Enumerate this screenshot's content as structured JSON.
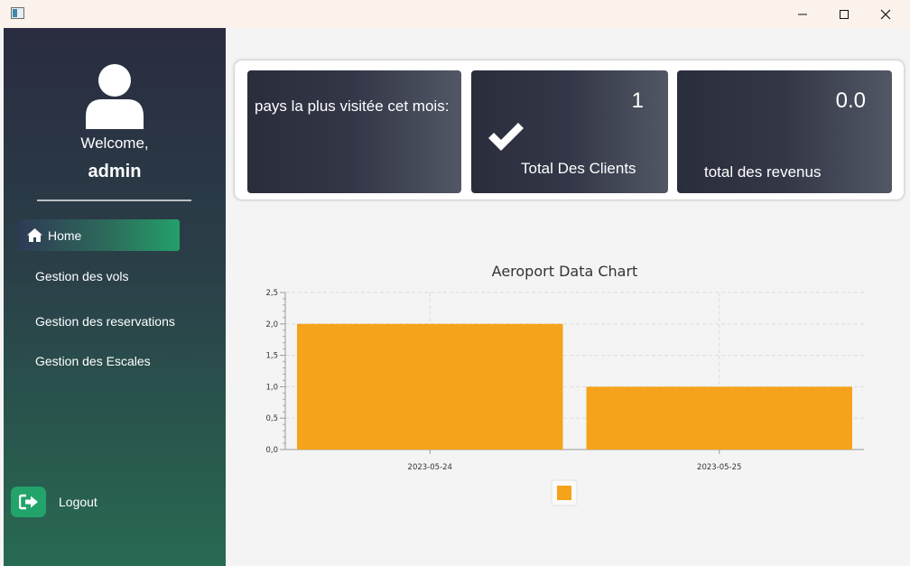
{
  "window": {
    "minimize_glyph": "—",
    "maximize_glyph": "☐",
    "close_glyph": "✕"
  },
  "sidebar": {
    "welcome_text": "Welcome,",
    "username": "admin",
    "avatar_icon": "user-icon",
    "nav": [
      {
        "label": "Home",
        "icon": "home-icon",
        "active": true
      },
      {
        "label": "Gestion des vols"
      },
      {
        "label": "Gestion des reservations"
      },
      {
        "label": "Gestion des Escales"
      }
    ],
    "logout": {
      "label": "Logout",
      "icon": "logout-icon"
    },
    "colors": {
      "top": "#2a2c40",
      "bottom": "#286a52",
      "accent": "#22a36a"
    }
  },
  "stats": {
    "card1": {
      "label": "pays la plus visitée cet mois:",
      "value": ""
    },
    "card2": {
      "label": "Total Des Clients",
      "value": "1",
      "icon": "check-icon"
    },
    "card3": {
      "label": "total des revenus",
      "value": "0.0"
    }
  },
  "chart_data": {
    "type": "bar",
    "title": "Aeroport Data Chart",
    "xlabel": "",
    "ylabel": "",
    "categories": [
      "2023-05-24",
      "2023-05-25"
    ],
    "series": [
      {
        "values": [
          2,
          1
        ],
        "color": "#f5a31a"
      }
    ],
    "ylim": [
      0,
      2.5
    ],
    "yticks": [
      "0,0",
      "0,5",
      "1,0",
      "1,5",
      "2,0",
      "2,5"
    ],
    "grid": true,
    "legend": "bottom"
  }
}
